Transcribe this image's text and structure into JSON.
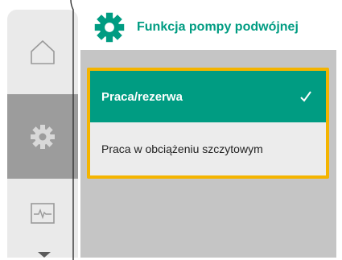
{
  "header": {
    "title": "Funkcja pompy podwójnej",
    "icon": "gear-icon"
  },
  "sidebar": {
    "items": [
      {
        "name": "home",
        "icon": "home-icon",
        "active": false
      },
      {
        "name": "settings",
        "icon": "gear-icon",
        "active": true
      },
      {
        "name": "monitor",
        "icon": "pulse-monitor-icon",
        "active": false
      }
    ],
    "scroll_icon": "chevron-down-icon"
  },
  "menu": {
    "items": [
      {
        "label": "Praca/rezerwa",
        "selected": true,
        "icon": "checkmark-icon"
      },
      {
        "label": "Praca w obciążeniu szczytowym",
        "selected": false
      }
    ]
  },
  "colors": {
    "accent": "#009c82",
    "focus": "#f4b400",
    "sidebar_bg": "#eaeaea",
    "sidebar_active": "#9c9c9c",
    "content_bg": "#c5c5c5"
  }
}
